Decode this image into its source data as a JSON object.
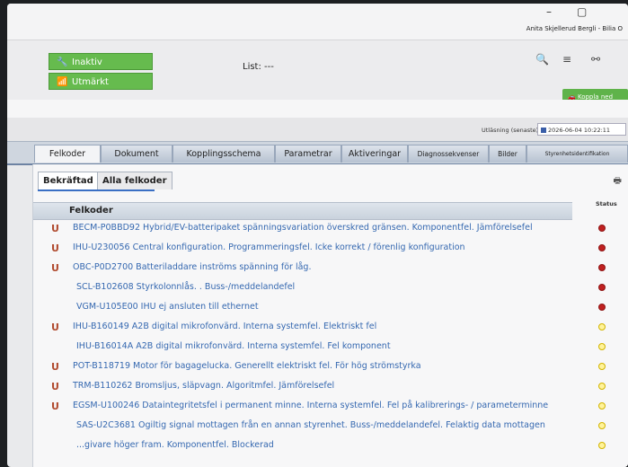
{
  "window": {
    "controls": [
      "–",
      "▢"
    ],
    "user": "Anita Skjellerud Bergli - Bilia O"
  },
  "toolbar": {
    "status_inactive": "Inaktiv",
    "status_signal": "Utmärkt",
    "list_label": "List: ---",
    "couple_button": "Koppla ned"
  },
  "readout": {
    "label": "Utläsning (senaste)",
    "value": "2026-06-04 10:22:11"
  },
  "tabs": [
    {
      "label": "Felkoder"
    },
    {
      "label": "Dokument"
    },
    {
      "label": "Kopplingsschema"
    },
    {
      "label": "Parametrar"
    },
    {
      "label": "Aktiveringar"
    },
    {
      "label": "Diagnossekvenser"
    },
    {
      "label": "Bilder"
    },
    {
      "label": "Styrenhetsidentifikation"
    }
  ],
  "subtabs": {
    "confirmed": "Bekräftad",
    "all": "Alla felkoder"
  },
  "table": {
    "column_header": "Felkoder",
    "status_header": "Status",
    "rows": [
      {
        "text": "BECM-P0BBD92 Hybrid/EV-batteripaket spänningsvariation överskred gränsen. Komponentfel. Jämförelsefel",
        "icon": true,
        "status": "red"
      },
      {
        "text": "IHU-U230056 Central konfiguration. Programmeringsfel. Icke korrekt / förenlig konfiguration",
        "icon": true,
        "status": "red"
      },
      {
        "text": "OBC-P0D2700 Batteriladdare inströms spänning för låg.",
        "icon": true,
        "status": "red"
      },
      {
        "text": "SCL-B102608 Styrkolonnlås. . Buss-/meddelandefel",
        "icon": false,
        "status": "red"
      },
      {
        "text": "VGM-U105E00 IHU ej ansluten till ethernet",
        "icon": false,
        "status": "red"
      },
      {
        "text": "IHU-B160149 A2B digital mikrofonvärd. Interna systemfel. Elektriskt fel",
        "icon": true,
        "status": "yellow"
      },
      {
        "text": "IHU-B16014A A2B digital mikrofonvärd. Interna systemfel. Fel komponent",
        "icon": false,
        "status": "yellow"
      },
      {
        "text": "POT-B118719 Motor för bagagelucka. Generellt elektriskt fel. För hög strömstyrka",
        "icon": true,
        "status": "yellow"
      },
      {
        "text": "TRM-B110262 Bromsljus, släpvagn. Algoritmfel. Jämförelsefel",
        "icon": true,
        "status": "yellow"
      },
      {
        "text": "EGSM-U100246 Dataintegritetsfel i permanent minne. Interna systemfel. Fel på kalibrerings- / parameterminne",
        "icon": true,
        "status": "yellow"
      },
      {
        "text": "SAS-U2C3681 Ogiltig signal mottagen från en annan styrenhet. Buss-/meddelandefel. Felaktig data mottagen",
        "icon": false,
        "status": "yellow"
      },
      {
        "text": "...givare höger fram. Komponentfel. Blockerad",
        "icon": false,
        "status": "yellow"
      }
    ]
  },
  "icons": {
    "magnet": "Ս",
    "wrench": "🔧",
    "wifi": "📶",
    "search": "🔍",
    "menu": "≡",
    "link": "⚯",
    "print": "🖶",
    "car": "🚗"
  },
  "colors": {
    "status_green": "#66bb4e",
    "link_blue": "#3568b0",
    "status_red": "#c02020",
    "status_yellow": "#fff39a"
  }
}
